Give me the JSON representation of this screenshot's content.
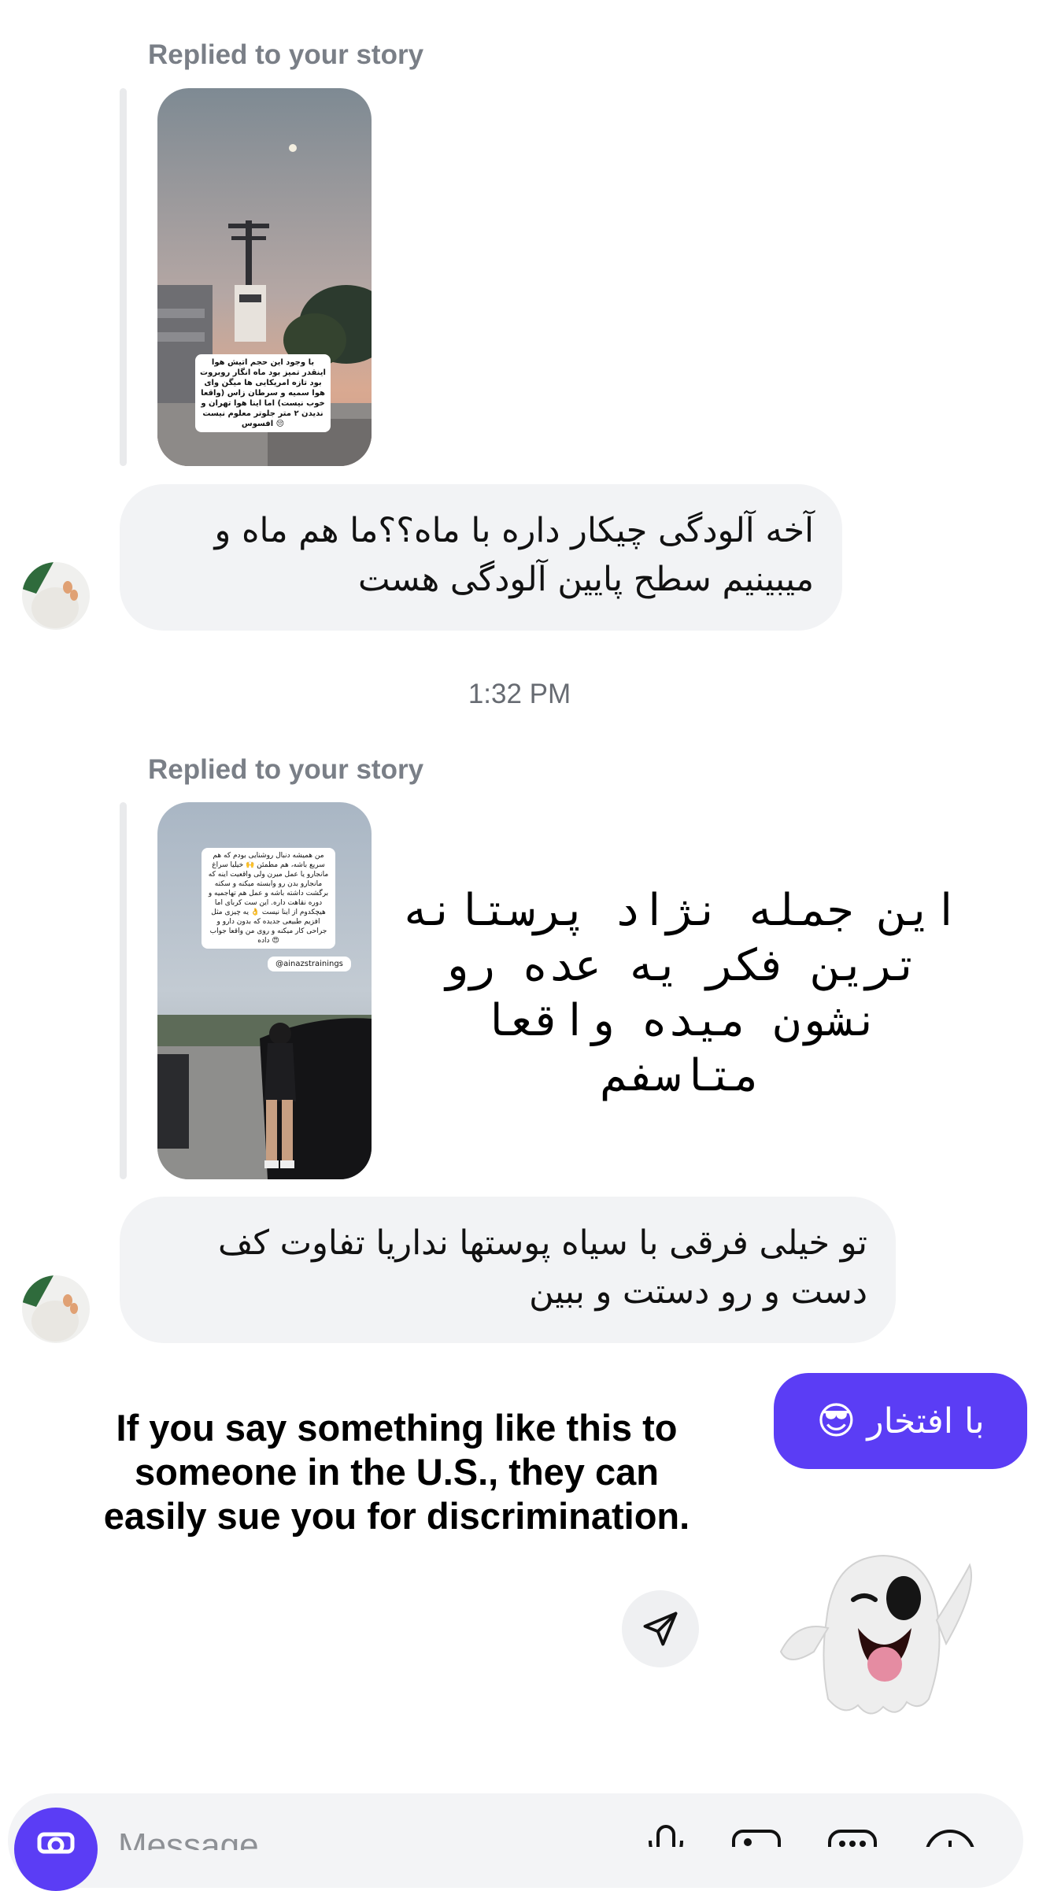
{
  "thread": {
    "reply1": {
      "label": "Replied to your story",
      "story_caption": "با وجود این حجم اتیش هوا اینقدر تمیز بود ماه انگار روبروت بود تازه امریکایی ها میگن وای هوا سمیه و سرطان زاس (واقعا خوب نیست) اما اینا هوا تهران و ندیدن ۲ متر جلوتر معلوم نیست 😔 افسوس",
      "message": "آخه آلودگی چیکار داره با ماه؟؟ما هم ماه و میبینیم سطح پایین آلودگی هست"
    },
    "timestamp": "1:32 PM",
    "reply2": {
      "label": "Replied to your story",
      "story_caption": "من همیشه دنبال روشنایی بودم که هم سریع باشه، هم مطمئن 🙌 خیلیا سراغ مانجارو یا عمل میرن ولی واقعیت اینه که مانجارو بدن رو وابسته میکنه و سکته برگشت داشته باشه و عمل هم تهاجمیه و دوره نقاهت داره. این ست کربای اما هیچکدوم از اینا نیست 👌 یه چیزی مثل افزیم طبیعی جدیده که بدون دارو و جراحی کار میکنه و روی من واقعا جواب داده 😍",
      "story_handle": "@ainazstrainings",
      "overlay_text": "این جمله نژاد پرستانه ترین فکر یه عده رو نشون میده واقعا متاسفم",
      "message": "تو خیلی فرقی با سیاه پوستها نداریا تفاوت کف دست و رو دستت و ببین"
    },
    "outgoing": {
      "text": "با افتخار",
      "emoji": "😎"
    },
    "caption_overlay": "If you say something like this to someone in the U.S., they can easily sue you for discrimination."
  },
  "composer": {
    "placeholder": "Message",
    "icons": [
      "camera-icon",
      "microphone-icon",
      "gallery-icon",
      "sticker-icon",
      "plus-icon"
    ]
  },
  "colors": {
    "accent": "#5b3df5",
    "bubble_incoming": "#f2f3f5",
    "label_gray": "#7a7f87"
  }
}
